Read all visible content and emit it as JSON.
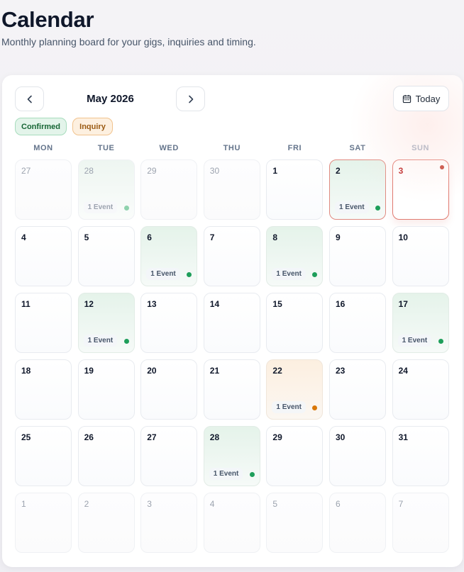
{
  "page": {
    "title": "Calendar",
    "subtitle": "Monthly planning board for your gigs, inquiries and timing."
  },
  "toolbar": {
    "month_label": "May 2026",
    "today_label": "Today",
    "prev_icon": "chevron-left-icon",
    "next_icon": "chevron-right-icon",
    "today_icon": "calendar-icon"
  },
  "legend": {
    "confirmed": "Confirmed",
    "inquiry": "Inquiry"
  },
  "colors": {
    "confirmed": "#1e9e5a",
    "confirmed_muted": "#8fd2ad",
    "inquiry": "#d97706",
    "today_marker": "#c0392b"
  },
  "weekdays": [
    "MON",
    "TUE",
    "WED",
    "THU",
    "FRI",
    "SAT",
    "SUN"
  ],
  "days": [
    {
      "day": "27",
      "outside": true
    },
    {
      "day": "28",
      "outside": true,
      "event": "1 Event",
      "status": "confirmed"
    },
    {
      "day": "29",
      "outside": true
    },
    {
      "day": "30",
      "outside": true
    },
    {
      "day": "1"
    },
    {
      "day": "2",
      "event": "1 Event",
      "status": "confirmed",
      "selected": true
    },
    {
      "day": "3",
      "today": true
    },
    {
      "day": "4"
    },
    {
      "day": "5"
    },
    {
      "day": "6",
      "event": "1 Event",
      "status": "confirmed"
    },
    {
      "day": "7"
    },
    {
      "day": "8",
      "event": "1 Event",
      "status": "confirmed"
    },
    {
      "day": "9"
    },
    {
      "day": "10"
    },
    {
      "day": "11"
    },
    {
      "day": "12",
      "event": "1 Event",
      "status": "confirmed"
    },
    {
      "day": "13"
    },
    {
      "day": "14"
    },
    {
      "day": "15"
    },
    {
      "day": "16"
    },
    {
      "day": "17",
      "event": "1 Event",
      "status": "confirmed"
    },
    {
      "day": "18"
    },
    {
      "day": "19"
    },
    {
      "day": "20"
    },
    {
      "day": "21"
    },
    {
      "day": "22",
      "event": "1 Event",
      "status": "inquiry"
    },
    {
      "day": "23"
    },
    {
      "day": "24"
    },
    {
      "day": "25"
    },
    {
      "day": "26"
    },
    {
      "day": "27"
    },
    {
      "day": "28",
      "event": "1 Event",
      "status": "confirmed"
    },
    {
      "day": "29"
    },
    {
      "day": "30"
    },
    {
      "day": "31"
    },
    {
      "day": "1",
      "outside": true
    },
    {
      "day": "2",
      "outside": true
    },
    {
      "day": "3",
      "outside": true
    },
    {
      "day": "4",
      "outside": true
    },
    {
      "day": "5",
      "outside": true
    },
    {
      "day": "6",
      "outside": true
    },
    {
      "day": "7",
      "outside": true
    }
  ]
}
